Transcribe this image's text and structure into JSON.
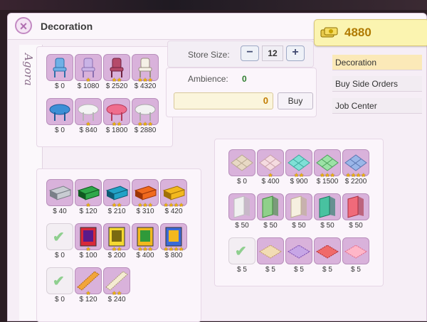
{
  "header": {
    "title": "Decoration"
  },
  "coins": {
    "amount": "4880"
  },
  "sidebar": {
    "tab_label": "Agora"
  },
  "store": {
    "size_label": "Store Size:",
    "size_value": "12",
    "minus": "−",
    "plus": "+"
  },
  "ambience": {
    "label": "Ambience:",
    "value": "0",
    "amount": "0",
    "buy_label": "Buy"
  },
  "menu": {
    "items": [
      {
        "label": "Decoration"
      },
      {
        "label": "Buy Side Orders"
      },
      {
        "label": "Job Center"
      }
    ]
  },
  "furniture": [
    {
      "price": "$ 0",
      "stars": "",
      "kind": "chair-blue"
    },
    {
      "price": "$ 1080",
      "stars": "★",
      "kind": "chair-lilac"
    },
    {
      "price": "$ 2520",
      "stars": "★★",
      "kind": "chair-red"
    },
    {
      "price": "$ 4320",
      "stars": "★★★",
      "kind": "chair-white"
    },
    {
      "price": "$ 0",
      "stars": "",
      "kind": "table-blue"
    },
    {
      "price": "$ 840",
      "stars": "★",
      "kind": "table-white"
    },
    {
      "price": "$ 1800",
      "stars": "★★",
      "kind": "table-pink"
    },
    {
      "price": "$ 2880",
      "stars": "★★★",
      "kind": "table-cloth"
    }
  ],
  "counters": [
    {
      "price": "$ 40",
      "stars": "",
      "kind": "counter-silver"
    },
    {
      "price": "$ 120",
      "stars": "★",
      "kind": "counter-green"
    },
    {
      "price": "$ 210",
      "stars": "★★",
      "kind": "counter-teal"
    },
    {
      "price": "$ 310",
      "stars": "★★★",
      "kind": "counter-orange"
    },
    {
      "price": "$ 420",
      "stars": "★★★★",
      "kind": "counter-gold"
    },
    {
      "price": "$ 0",
      "stars": "",
      "kind": "empty"
    },
    {
      "price": "$ 100",
      "stars": "★",
      "kind": "poster-red"
    },
    {
      "price": "$ 200",
      "stars": "★★",
      "kind": "poster-yellow"
    },
    {
      "price": "$ 400",
      "stars": "★★★",
      "kind": "poster-green"
    },
    {
      "price": "$ 800",
      "stars": "★★★★",
      "kind": "poster-blue"
    },
    {
      "price": "$ 0",
      "stars": "",
      "kind": "empty"
    },
    {
      "price": "$ 120",
      "stars": "★",
      "kind": "border-orange"
    },
    {
      "price": "$ 240",
      "stars": "★★",
      "kind": "border-cream"
    }
  ],
  "floors": [
    {
      "price": "$ 0",
      "stars": "",
      "kind": "floor-beige"
    },
    {
      "price": "$ 400",
      "stars": "★",
      "kind": "floor-pink"
    },
    {
      "price": "$ 900",
      "stars": "★★",
      "kind": "floor-aqua"
    },
    {
      "price": "$ 1500",
      "stars": "★★★",
      "kind": "floor-green"
    },
    {
      "price": "$ 2200",
      "stars": "★★★★",
      "kind": "floor-blue"
    },
    {
      "price": "$ 50",
      "stars": "",
      "kind": "wall-white"
    },
    {
      "price": "$ 50",
      "stars": "",
      "kind": "wall-green"
    },
    {
      "price": "$ 50",
      "stars": "",
      "kind": "wall-cream"
    },
    {
      "price": "$ 50",
      "stars": "",
      "kind": "wall-teal"
    },
    {
      "price": "$ 50",
      "stars": "",
      "kind": "wall-red"
    },
    {
      "price": "$ 5",
      "stars": "",
      "kind": "rug-empty"
    },
    {
      "price": "$ 5",
      "stars": "",
      "kind": "rug-tan"
    },
    {
      "price": "$ 5",
      "stars": "",
      "kind": "rug-purple"
    },
    {
      "price": "$ 5",
      "stars": "",
      "kind": "rug-red"
    },
    {
      "price": "$ 5",
      "stars": "",
      "kind": "rug-pink"
    }
  ],
  "colors": {
    "accent": "#c38ac3",
    "coin": "#b07a00",
    "active_tab": "#fbe9b8"
  }
}
